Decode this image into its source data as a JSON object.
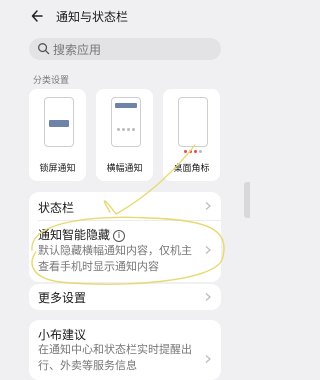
{
  "header": {
    "title": "通知与状态栏"
  },
  "search": {
    "placeholder": "搜索应用"
  },
  "category": {
    "label": "分类设置",
    "cards": [
      {
        "label": "锁屏通知"
      },
      {
        "label": "横幅通知"
      },
      {
        "label": "桌面角标"
      }
    ]
  },
  "rows": {
    "status_bar": "状态栏",
    "smart_hide_title": "通知智能隐藏",
    "smart_hide_desc": "默认隐藏横幅通知内容，仅机主查看手机时显示通知内容",
    "more_settings": "更多设置",
    "suggest_title": "小布建议",
    "suggest_desc": "在通知中心和状态栏实时提醒出行、外卖等服务信息"
  },
  "colors": {
    "accent_block": "#6f82a8",
    "badge_dot": "#e94a4a",
    "annotation": "#e8d870"
  }
}
